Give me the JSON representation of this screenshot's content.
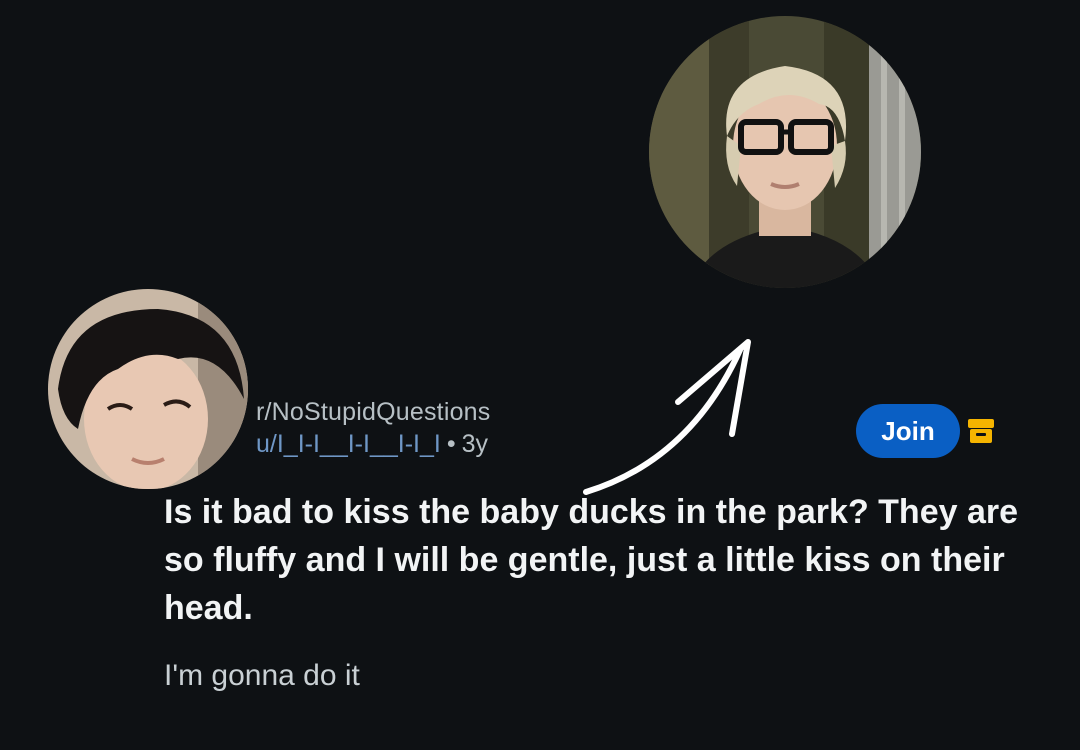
{
  "post": {
    "subreddit": "r/NoStupidQuestions",
    "username": "u/I_I-I__I-I__I-I_I",
    "separator": "•",
    "age": "3y",
    "title": "Is it bad to kiss the baby ducks in the park? They are so fluffy and I will be gentle, just a little kiss on their head.",
    "body": "I'm gonna do it"
  },
  "actions": {
    "join_label": "Join"
  },
  "colors": {
    "background": "#0e1114",
    "join_button": "#0a5fc4",
    "username_link": "#6f97c6",
    "archive_icon": "#f5b400",
    "arrow": "#ffffff"
  },
  "icons": {
    "archive": "archive-icon",
    "arrow": "curved-arrow-annotation"
  }
}
